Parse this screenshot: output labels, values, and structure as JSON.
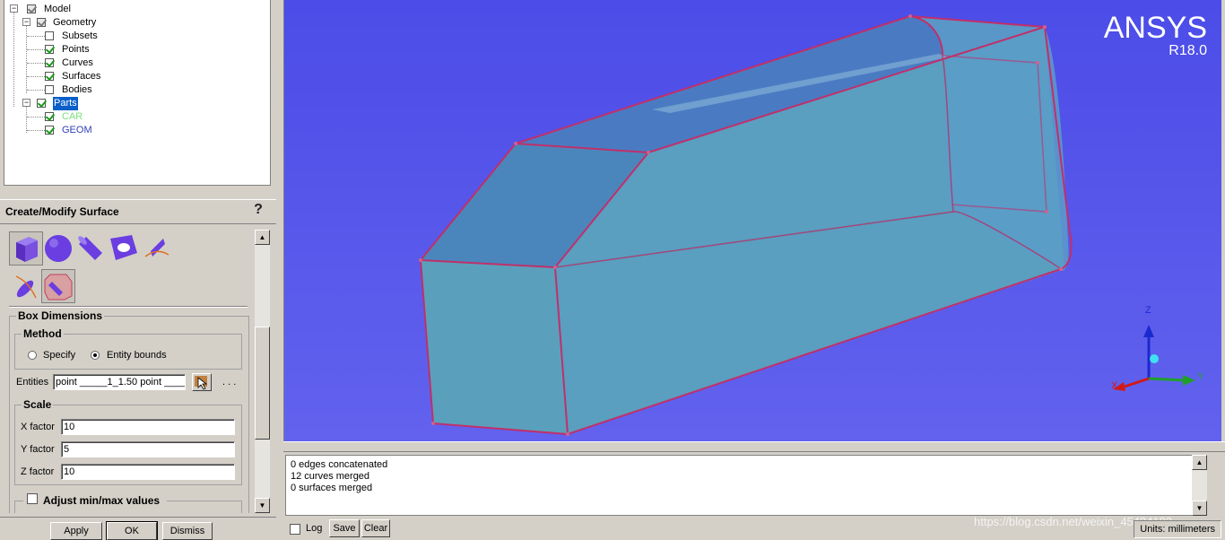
{
  "tree": {
    "model": "Model",
    "geometry": "Geometry",
    "subsets": "Subsets",
    "points": "Points",
    "curves": "Curves",
    "surfaces": "Surfaces",
    "bodies": "Bodies",
    "parts": "Parts",
    "car": "CAR",
    "geom": "GEOM",
    "car_color": "#7ee07e",
    "geom_color": "#2f3fb8"
  },
  "panel": {
    "title": "Create/Modify Surface",
    "box_dimensions": "Box Dimensions",
    "method": "Method",
    "specify": "Specify",
    "entity_bounds": "Entity bounds",
    "entities_label": "Entities",
    "entities_value": "point _____1_1.50 point _____",
    "ellipsis": ". . .",
    "scale": "Scale",
    "x_label": "X factor",
    "x_value": "10",
    "y_label": "Y factor",
    "y_value": "5",
    "z_label": "Z factor",
    "z_value": "10",
    "adjust": "Adjust min/max values"
  },
  "buttons": {
    "apply": "Apply",
    "ok": "OK",
    "dismiss": "Dismiss",
    "save": "Save",
    "clear": "Clear",
    "log": "Log"
  },
  "brand": {
    "name": "ANSYS",
    "version": "R18.0"
  },
  "axes": {
    "z": "Z",
    "x": "X",
    "y": "Y"
  },
  "messages": [
    "0 edges concatenated",
    "12 curves merged",
    "0 surfaces merged"
  ],
  "units": "Units: millimeters",
  "watermark": "https://blog.csdn.net/weixin_45434183",
  "colors": {
    "viewport_bg": "#5858ec",
    "solid_fill": "#4f93b8",
    "edge": "#c0306a",
    "selection": "#0a5fc9"
  }
}
